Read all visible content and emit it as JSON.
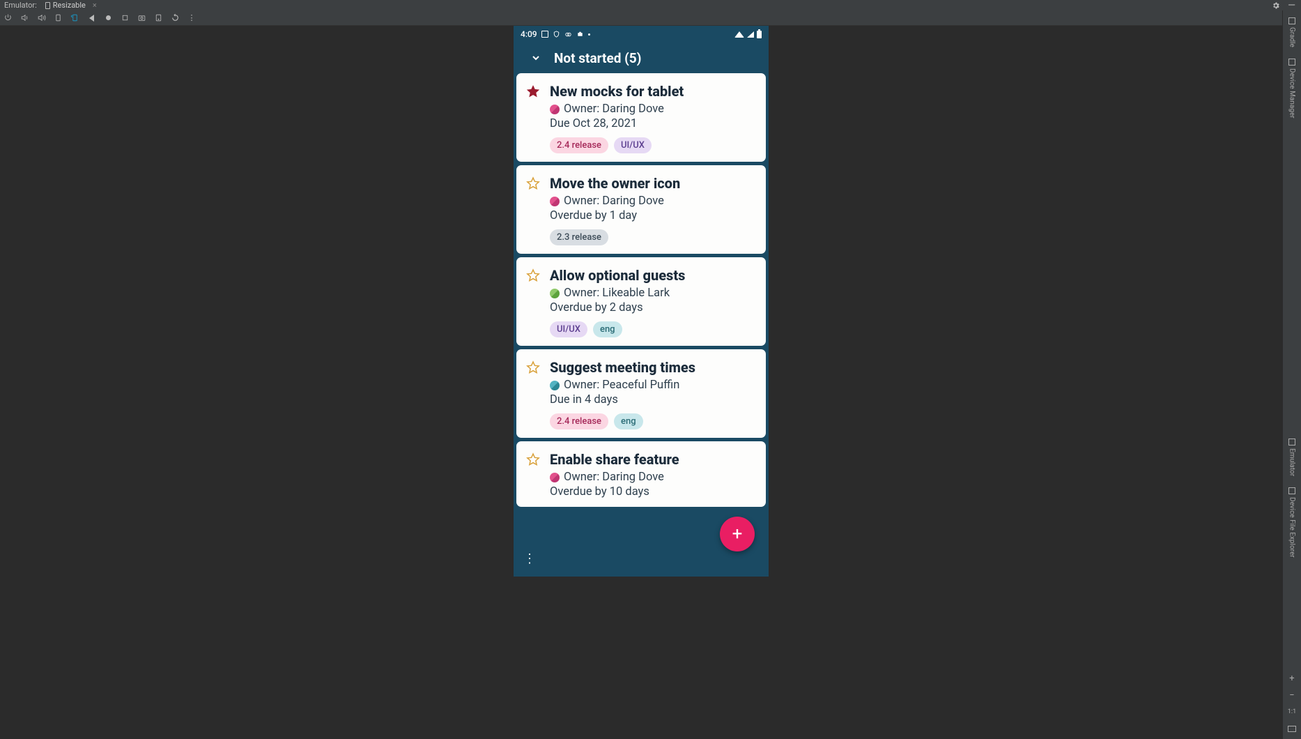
{
  "ide": {
    "emulator_label": "Emulator:",
    "tab_name": "Resizable"
  },
  "right_rail": {
    "gradle": "Gradle",
    "device_manager": "Device Manager",
    "emulator": "Emulator",
    "file_explorer": "Device File Explorer",
    "one_to_one": "1:1"
  },
  "status": {
    "time": "4:09"
  },
  "section": {
    "title": "Not started (5)"
  },
  "fab": "+",
  "tag_styles": {
    "2.4 release": "pink",
    "2.3 release": "gray",
    "UI/UX": "purple",
    "eng": "teal"
  },
  "tasks": [
    {
      "title": "New mocks for tablet",
      "starred": true,
      "owner": "Owner: Daring Dove",
      "avatar": "pink",
      "due": "Due Oct 28, 2021",
      "tags": [
        "2.4 release",
        "UI/UX"
      ]
    },
    {
      "title": "Move the owner icon",
      "starred": false,
      "owner": "Owner: Daring Dove",
      "avatar": "pink",
      "due": "Overdue by 1 day",
      "tags": [
        "2.3 release"
      ]
    },
    {
      "title": "Allow optional guests",
      "starred": false,
      "owner": "Owner: Likeable Lark",
      "avatar": "green",
      "due": "Overdue by 2 days",
      "tags": [
        "UI/UX",
        "eng"
      ]
    },
    {
      "title": "Suggest meeting times",
      "starred": false,
      "owner": "Owner: Peaceful Puffin",
      "avatar": "teal",
      "due": "Due in 4 days",
      "tags": [
        "2.4 release",
        "eng"
      ]
    },
    {
      "title": "Enable share feature",
      "starred": false,
      "owner": "Owner: Daring Dove",
      "avatar": "pink",
      "due": "Overdue by 10 days",
      "tags": []
    }
  ]
}
